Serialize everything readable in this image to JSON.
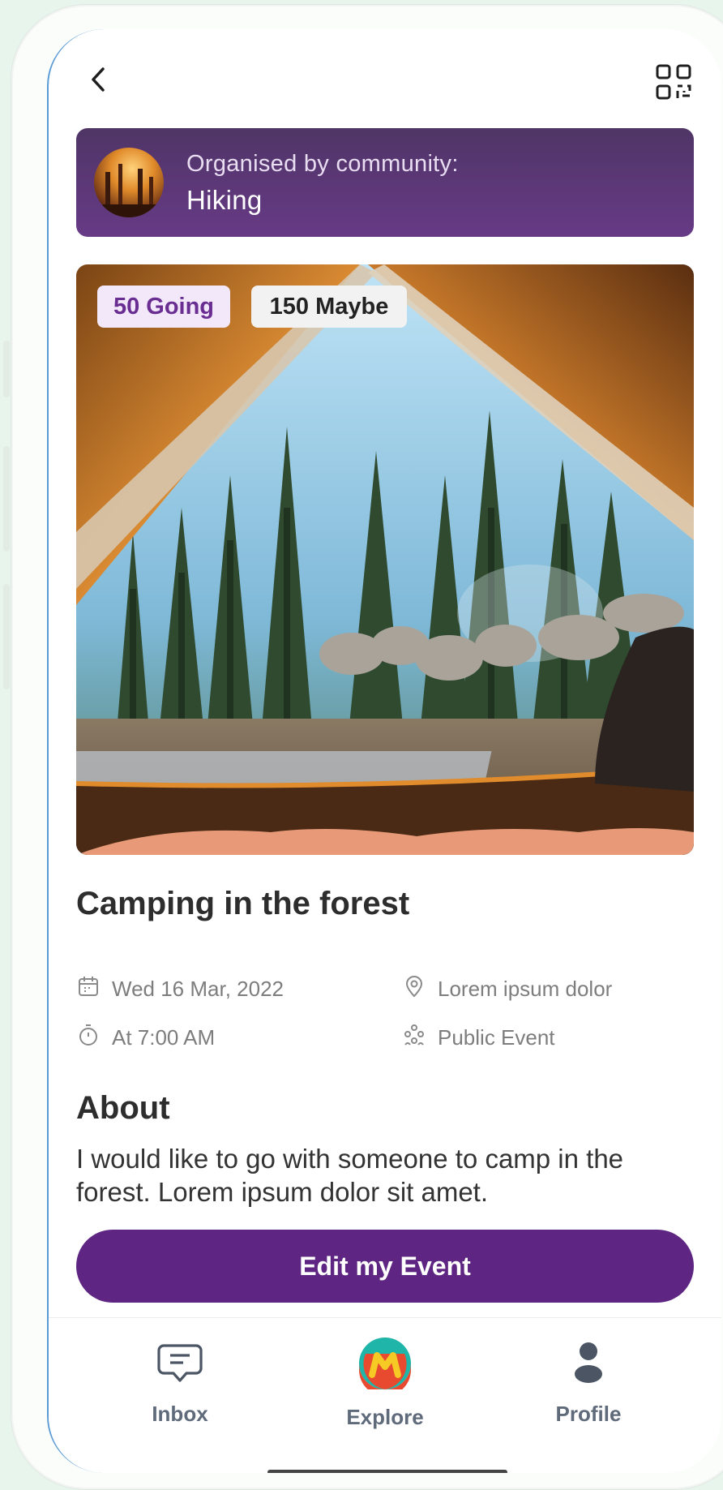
{
  "organizer": {
    "caption": "Organised by community:",
    "name": "Hiking"
  },
  "attendance": {
    "going": "50 Going",
    "maybe": "150 Maybe"
  },
  "event": {
    "title": "Camping in the forest",
    "date": "Wed 16 Mar, 2022",
    "location": "Lorem ipsum dolor",
    "time": "At 7:00 AM",
    "visibility": "Public Event"
  },
  "about": {
    "heading": "About",
    "text": "I would like to go with someone to camp in the forest. Lorem ipsum dolor sit amet."
  },
  "actions": {
    "edit_label": "Edit my Event"
  },
  "tabbar": {
    "tabs": [
      {
        "label": "Inbox",
        "icon": "chat-bubble-icon"
      },
      {
        "label": "Explore",
        "icon": "explore-logo-icon"
      },
      {
        "label": "Profile",
        "icon": "person-icon"
      }
    ]
  },
  "colors": {
    "brand_purple": "#5e2682",
    "banner_purple": "#673a86",
    "going_badge_bg": "#f2e8fa"
  }
}
